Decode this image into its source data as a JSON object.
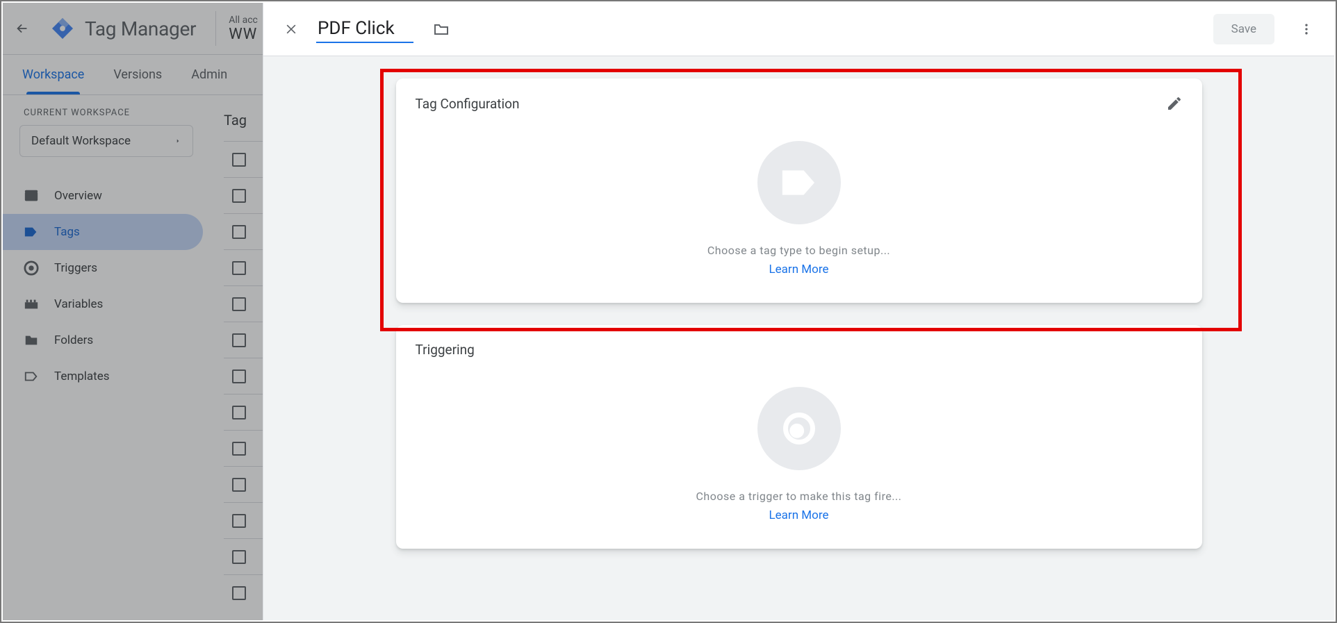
{
  "header": {
    "app_title": "Tag Manager",
    "accounts_label": "All acc",
    "account_name": "WW"
  },
  "tabs": {
    "workspace": "Workspace",
    "versions": "Versions",
    "admin": "Admin"
  },
  "sidebar": {
    "current_ws_label": "CURRENT WORKSPACE",
    "workspace_name": "Default Workspace",
    "items": [
      {
        "label": "Overview"
      },
      {
        "label": "Tags"
      },
      {
        "label": "Triggers"
      },
      {
        "label": "Variables"
      },
      {
        "label": "Folders"
      },
      {
        "label": "Templates"
      }
    ]
  },
  "content_area": {
    "title_truncated": "Tag"
  },
  "panel": {
    "tag_name": "PDF Click",
    "save_label": "Save",
    "cards": {
      "tag_config": {
        "title": "Tag Configuration",
        "hint": "Choose a tag type to begin setup...",
        "learn_more": "Learn More"
      },
      "triggering": {
        "title": "Triggering",
        "hint": "Choose a trigger to make this tag fire...",
        "learn_more": "Learn More"
      }
    }
  }
}
